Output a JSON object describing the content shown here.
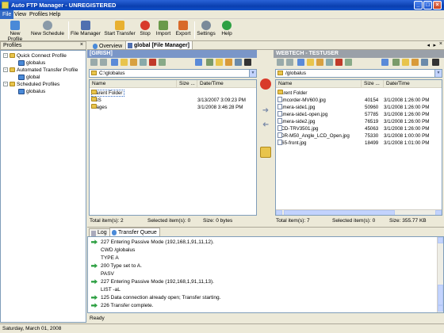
{
  "window": {
    "title": "Auto FTP Manager - UNREGISTERED",
    "min": "_",
    "max": "□",
    "close": "×"
  },
  "menu": [
    "File",
    "View",
    "Profiles",
    "Help"
  ],
  "toolbar": [
    {
      "label": "New Profile",
      "icon": "new-profile-icon",
      "color": "#4a8ad8"
    },
    {
      "label": "New Schedule",
      "icon": "new-schedule-icon",
      "color": "#8a9aa8"
    },
    {
      "label": "File Manager",
      "icon": "file-manager-icon",
      "color": "#5070b0"
    },
    {
      "label": "Start Transfer",
      "icon": "start-transfer-icon",
      "color": "#e8b030"
    },
    {
      "label": "Stop",
      "icon": "stop-icon",
      "color": "#d83a2a"
    },
    {
      "label": "Import",
      "icon": "import-icon",
      "color": "#6a9a4a"
    },
    {
      "label": "Export",
      "icon": "export-icon",
      "color": "#d86a2a"
    },
    {
      "label": "Settings",
      "icon": "settings-icon",
      "color": "#7a8a9a"
    },
    {
      "label": "Help",
      "icon": "help-icon",
      "color": "#2ea043"
    }
  ],
  "sidebar": {
    "title": "Profiles",
    "close": "×",
    "groups": [
      {
        "label": "Quick Connect Profile",
        "child": "globalus"
      },
      {
        "label": "Automated Transfer Profile",
        "child": "global"
      },
      {
        "label": "Scheduled Profiles",
        "child": "globalus"
      }
    ]
  },
  "tabs": {
    "overview": "Overview",
    "active": "global [File Manager]"
  },
  "left_pane": {
    "server": "[GIRISH]",
    "path": "C:\\globalus",
    "columns": [
      "Name",
      "Size ...",
      "Date/Time"
    ],
    "rows": [
      {
        "name": "Parent Folder",
        "size": "",
        "date": "",
        "type": "folder",
        "selected": true
      },
      {
        "name": "CSS",
        "size": "",
        "date": "3/13/2007 3:09:23 PM",
        "type": "folder"
      },
      {
        "name": "images",
        "size": "",
        "date": "3/1/2008 3:46:28 PM",
        "type": "folder"
      }
    ],
    "status": {
      "total": "Total item(s): 2",
      "selected": "Selected item(s): 0",
      "size": "Size: 0 bytes"
    }
  },
  "right_pane": {
    "server": "WEBTECH - TESTUSER",
    "path": "/globalus",
    "columns": [
      "Name",
      "Size ...",
      "Date/Time"
    ],
    "rows": [
      {
        "name": "Parent Folder",
        "size": "",
        "date": "",
        "type": "folder"
      },
      {
        "name": "camcorder-MV600.jpg",
        "size": "40154",
        "date": "3/1/2008 1:26:00 PM",
        "type": "file"
      },
      {
        "name": "camera-side1.jpg",
        "size": "50960",
        "date": "3/1/2008 1:26:00 PM",
        "type": "file"
      },
      {
        "name": "camera-side1-open.jpg",
        "size": "57785",
        "date": "3/1/2008 1:26:00 PM",
        "type": "file"
      },
      {
        "name": "camera-side2.jpg",
        "size": "76519",
        "date": "3/1/2008 1:26:00 PM",
        "type": "file"
      },
      {
        "name": "CCD-TRV3501.jpg",
        "size": "45063",
        "date": "3/1/2008 1:26:00 PM",
        "type": "file"
      },
      {
        "name": "VDR-M50_Angle_LCD_Open.jpg",
        "size": "75330",
        "date": "3/1/2008 1:00:00 PM",
        "type": "file"
      },
      {
        "name": "zr65-front.jpg",
        "size": "18499",
        "date": "3/1/2008 1:01:00 PM",
        "type": "file"
      }
    ],
    "status": {
      "total": "Total item(s): 7",
      "selected": "Selected item(s): 0",
      "size": "Size: 355.77 KB"
    }
  },
  "log_tabs": [
    "Log",
    "Transfer Queue"
  ],
  "log": [
    {
      "text": "227 Entering Passive Mode (192,168,1,91,11,12).",
      "arrow": true
    },
    {
      "text": "CWD /globalus",
      "arrow": false
    },
    {
      "text": "TYPE A",
      "arrow": false
    },
    {
      "text": "200 Type set to A.",
      "arrow": true
    },
    {
      "text": "PASV",
      "arrow": false
    },
    {
      "text": "227 Entering Passive Mode (192,168,1,91,11,13).",
      "arrow": true
    },
    {
      "text": "LIST -aL",
      "arrow": false
    },
    {
      "text": "125 Data connection already open; Transfer starting.",
      "arrow": true
    },
    {
      "text": "226 Transfer complete.",
      "arrow": true
    }
  ],
  "ready": "Ready",
  "statusbar": "Saturday, March 01, 2008"
}
